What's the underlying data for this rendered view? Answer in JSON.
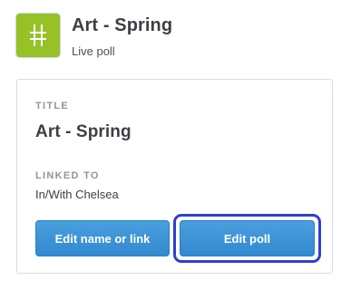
{
  "header": {
    "logo_icon": "hash-icon",
    "logo_color": "#96c127",
    "title": "Art - Spring",
    "status": "Live poll"
  },
  "card": {
    "title_label": "TITLE",
    "title_value": "Art - Spring",
    "linked_label": "LINKED TO",
    "linked_value": "In/With Chelsea",
    "buttons": {
      "edit_name_label": "Edit name or link",
      "edit_poll_label": "Edit poll"
    }
  },
  "colors": {
    "button_blue": "#3d93d8",
    "focus_ring": "#2f3fd0",
    "text_dark": "#3c4045",
    "label_gray": "#8e969c"
  }
}
